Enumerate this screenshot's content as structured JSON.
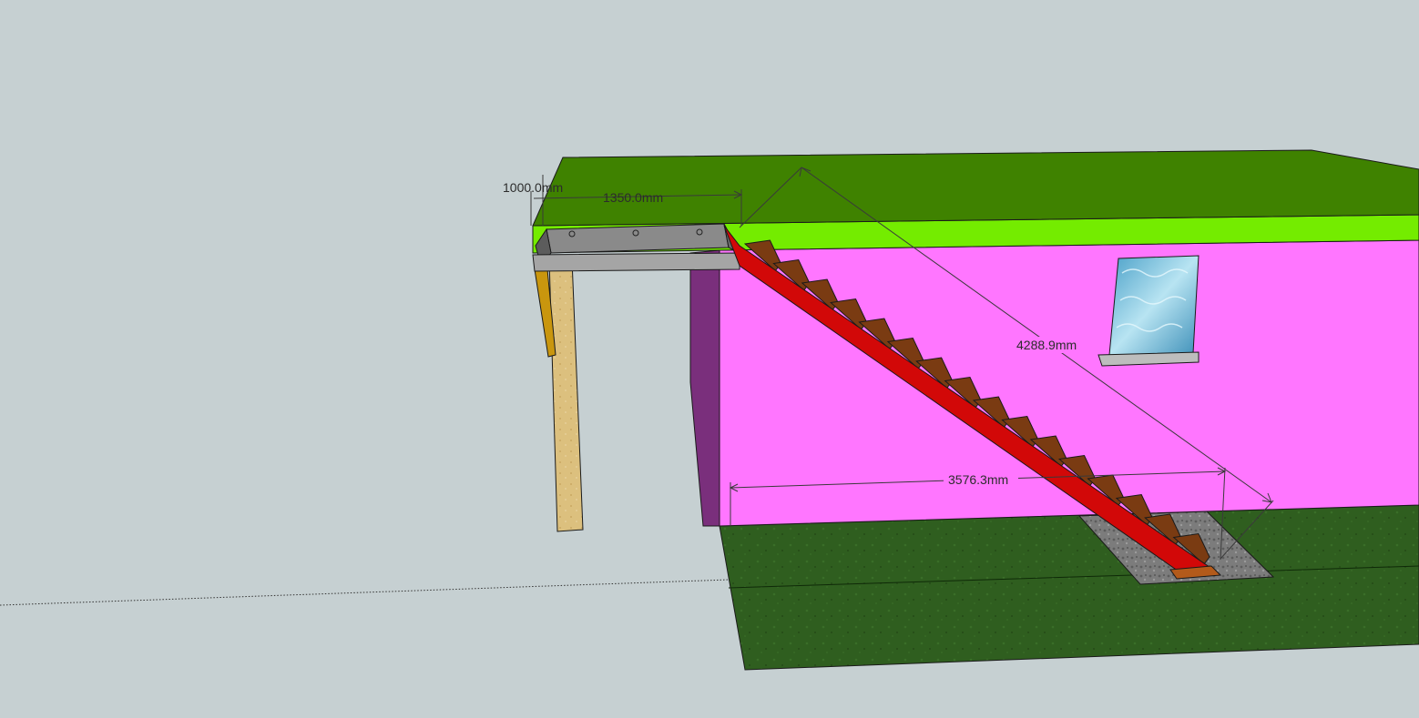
{
  "dimensions": {
    "height_label": "1000.0mm",
    "platform_width_label": "1350.0mm",
    "stair_length_label": "4288.9mm",
    "horizontal_run_label": "3576.3mm"
  },
  "colors": {
    "background": "#c6d0d2",
    "roof_top": "#3f8200",
    "roof_fascia": "#74ec00",
    "wall": "#ff76ff",
    "wall_side": "#7a2f7c",
    "ground": "#2f5e1f",
    "stringer": "#d20808",
    "tread": "#7a3b12",
    "platform_frame": "#8a8a8a",
    "post": "#dcc07e",
    "brace": "#c9960e",
    "window_glass": "#6ab7d9",
    "footing": "#7c7c7c"
  },
  "icons": {
    "window": "water-texture-window"
  }
}
